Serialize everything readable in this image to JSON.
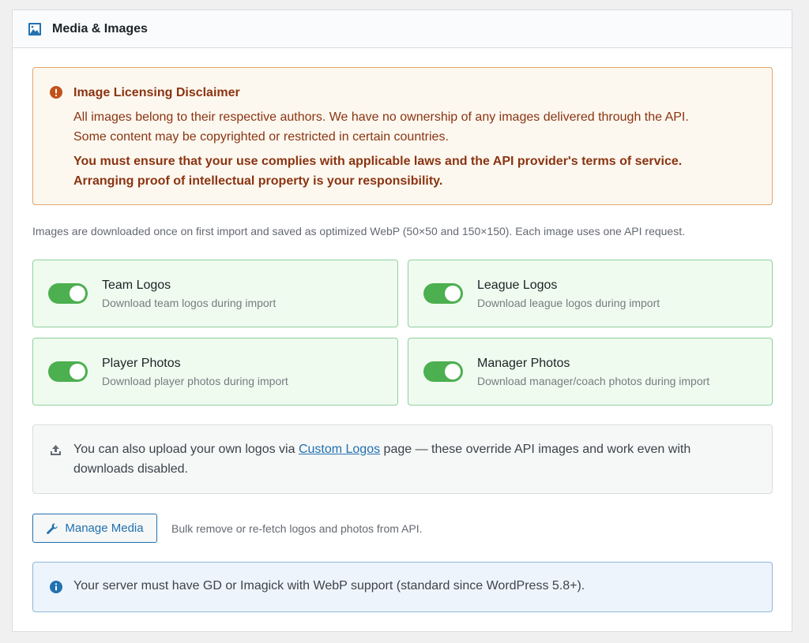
{
  "header": {
    "icon": "image-icon",
    "title": "Media & Images"
  },
  "disclaimer": {
    "icon": "warning-circle-icon",
    "title": "Image Licensing Disclaimer",
    "body_line1": "All images belong to their respective authors. We have no ownership of any images delivered through the API.",
    "body_line2": "Some content may be copyrighted or restricted in certain countries.",
    "strong_line1": "You must ensure that your use complies with applicable laws and the API provider's terms of service.",
    "strong_line2": "Arranging proof of intellectual property is your responsibility."
  },
  "info_text": "Images are downloaded once on first import and saved as optimized WebP (50×50 and 150×150). Each image uses one API request.",
  "options": [
    {
      "title": "Team Logos",
      "description": "Download team logos during import",
      "enabled": true
    },
    {
      "title": "League Logos",
      "description": "Download league logos during import",
      "enabled": true
    },
    {
      "title": "Player Photos",
      "description": "Download player photos during import",
      "enabled": true
    },
    {
      "title": "Manager Photos",
      "description": "Download manager/coach photos during import",
      "enabled": true
    }
  ],
  "upload_note": {
    "icon": "upload-icon",
    "prefix": "You can also upload your own logos via ",
    "link_text": "Custom Logos",
    "suffix": " page — these override API images and work even with downloads disabled."
  },
  "manage": {
    "icon": "wrench-icon",
    "button_label": "Manage Media",
    "description": "Bulk remove or re-fetch logos and photos from API."
  },
  "notice": {
    "icon": "info-icon",
    "text": "Your server must have GD or Imagick with WebP support (standard since WordPress 5.8+)."
  },
  "colors": {
    "toggle_on": "#4caf50",
    "disclaimer_text": "#8a3412",
    "link": "#2271b1"
  }
}
